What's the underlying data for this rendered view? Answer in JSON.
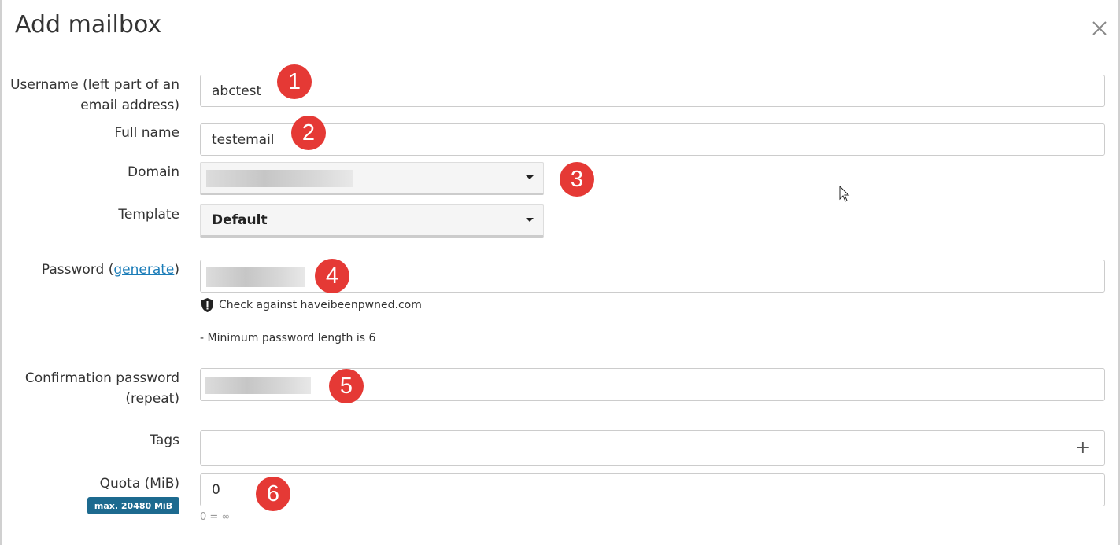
{
  "modal": {
    "title": "Add mailbox",
    "close_icon": "close-icon"
  },
  "form": {
    "username": {
      "label": "Username (left part of an email address)",
      "value": "abctest",
      "marker": "1"
    },
    "full_name": {
      "label": "Full name",
      "value": "testemail",
      "marker": "2"
    },
    "domain": {
      "label": "Domain",
      "marker": "3"
    },
    "template": {
      "label": "Template",
      "selected": "Default"
    },
    "password": {
      "label_prefix": "Password (",
      "generate_link": "generate",
      "label_suffix": ")",
      "marker": "4",
      "pwned_check": "Check against haveibeenpwned.com",
      "min_length_note": "- Minimum password length is 6"
    },
    "confirm_password": {
      "label": "Confirmation password (repeat)",
      "marker": "5"
    },
    "tags": {
      "label": "Tags",
      "add_icon": "+"
    },
    "quota": {
      "label": "Quota (MiB)",
      "value": "0",
      "max_badge": "max. 20480 MiB",
      "hint": "0 = ∞",
      "marker": "6"
    }
  },
  "colors": {
    "marker": "#e53935",
    "badge": "#1d6a8f",
    "link": "#1a7cb8"
  }
}
